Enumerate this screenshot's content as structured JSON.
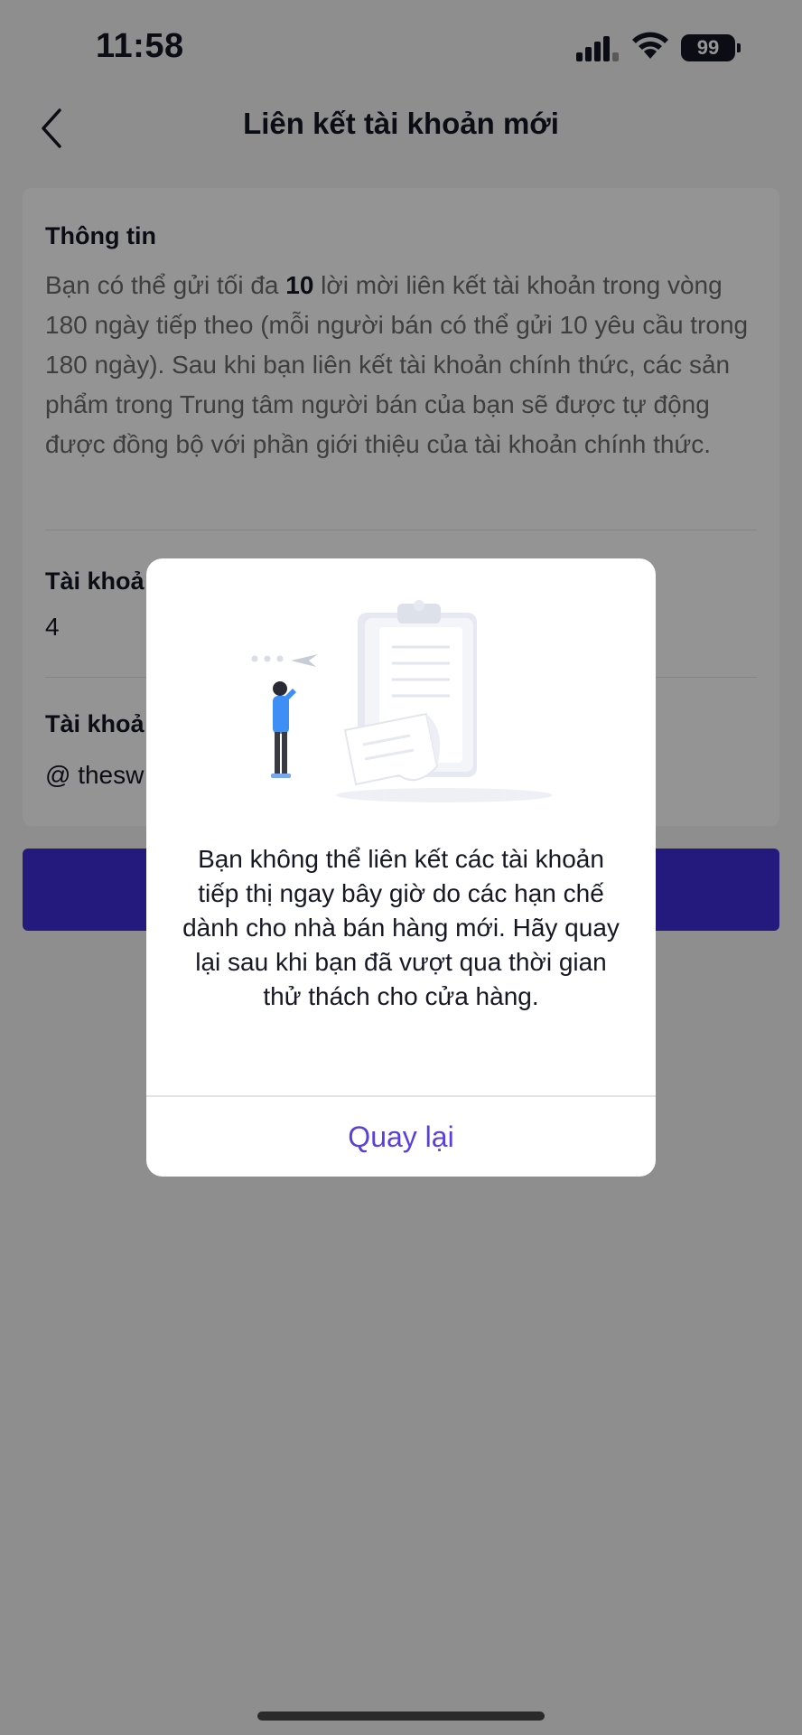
{
  "status_bar": {
    "time": "11:58",
    "battery": "99"
  },
  "header": {
    "title": "Liên kết tài khoản mới",
    "back_icon": "chevron-left-icon"
  },
  "info": {
    "title": "Thông tin",
    "text_before": "Bạn có thể gửi tối đa ",
    "highlight": "10",
    "text_after": " lời mời liên kết tài khoản trong vòng 180 ngày tiếp theo (mỗi người bán có thể gửi 10 yêu cầu trong 180 ngày). Sau khi bạn liên kết tài khoản chính thức, các sản phẩm trong Trung tâm người bán của bạn sẽ được tự động được đồng bộ với phần giới thiệu của tài khoản chính thức."
  },
  "section2": {
    "title": "Tài khoả",
    "value": "4"
  },
  "section3": {
    "title": "Tài khoả",
    "value": "@ thesw"
  },
  "modal": {
    "message": "Bạn không thể liên kết các tài khoản tiếp thị ngay bây giờ do các hạn chế dành cho nhà bán hàng mới. Hãy quay lại sau khi bạn đã vượt qua thời gian thử thách cho cửa hàng.",
    "button": "Quay lại"
  },
  "colors": {
    "accent": "#3f2bd8",
    "link": "#5a3fe0",
    "overlay": "rgba(0,0,0,0.42)"
  }
}
